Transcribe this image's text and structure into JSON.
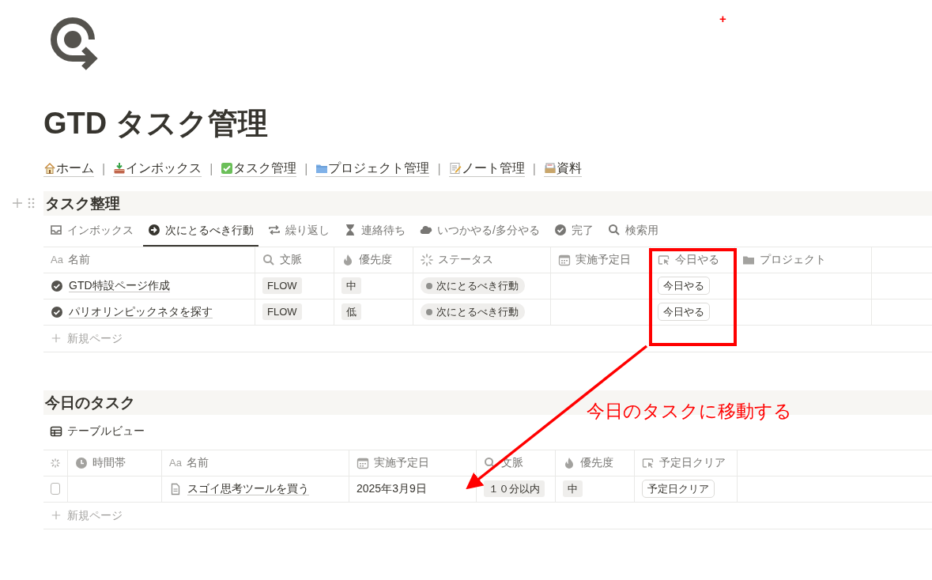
{
  "title": "GTD タスク管理",
  "links": [
    {
      "kind": "home",
      "label": "ホーム"
    },
    {
      "kind": "inbox",
      "label": "インボックス"
    },
    {
      "kind": "check",
      "label": "タスク管理"
    },
    {
      "kind": "folder",
      "label": "プロジェクト管理"
    },
    {
      "kind": "memo",
      "label": "ノート管理"
    },
    {
      "kind": "files",
      "label": "資料"
    }
  ],
  "link_separator": "|",
  "sections": [
    {
      "title": "タスク整理",
      "views": [
        {
          "kind": "inbox",
          "label": "インボックス",
          "selected": false
        },
        {
          "kind": "arrow",
          "label": "次にとるべき行動",
          "selected": true
        },
        {
          "kind": "repeat",
          "label": "繰り返し",
          "selected": false
        },
        {
          "kind": "hourglass",
          "label": "連絡待ち",
          "selected": false
        },
        {
          "kind": "cloud",
          "label": "いつかやる/多分やる",
          "selected": false
        },
        {
          "kind": "done",
          "label": "完了",
          "selected": false
        },
        {
          "kind": "search",
          "label": "検索用",
          "selected": false
        }
      ],
      "columns": [
        {
          "kind": "text",
          "prefix": "Aa",
          "label": "名前"
        },
        {
          "kind": "search",
          "label": "文脈"
        },
        {
          "kind": "fire",
          "label": "優先度"
        },
        {
          "kind": "spinner",
          "label": "ステータス"
        },
        {
          "kind": "calendar",
          "label": "実施予定日"
        },
        {
          "kind": "cursor",
          "label": "今日やる"
        },
        {
          "kind": "folder",
          "label": "プロジェクト"
        },
        {
          "kind": "blank"
        }
      ],
      "rows": [
        [
          {
            "kind": "done_title",
            "text": "GTD特設ページ作成"
          },
          {
            "kind": "tag",
            "text": "FLOW"
          },
          {
            "kind": "tag",
            "text": "中"
          },
          {
            "kind": "status",
            "text": "次にとるべき行動"
          },
          {
            "kind": "empty"
          },
          {
            "kind": "button",
            "text": "今日やる"
          },
          {
            "kind": "empty"
          },
          {
            "kind": "empty"
          }
        ],
        [
          {
            "kind": "done_title",
            "text": "パリオリンピックネタを探す"
          },
          {
            "kind": "tag",
            "text": "FLOW"
          },
          {
            "kind": "tag",
            "text": "低"
          },
          {
            "kind": "status",
            "text": "次にとるべき行動"
          },
          {
            "kind": "empty"
          },
          {
            "kind": "button",
            "text": "今日やる"
          },
          {
            "kind": "empty"
          },
          {
            "kind": "empty"
          }
        ]
      ],
      "new_row": "新規ページ"
    },
    {
      "title": "今日のタスク",
      "views": [
        {
          "kind": "table",
          "label": "テーブルビュー",
          "selected": true
        }
      ],
      "columns": [
        {
          "kind": "spinner"
        },
        {
          "kind": "clock",
          "label": "時間帯"
        },
        {
          "kind": "text",
          "prefix": "Aa",
          "label": "名前"
        },
        {
          "kind": "calendar",
          "label": "実施予定日"
        },
        {
          "kind": "search",
          "label": "文脈"
        },
        {
          "kind": "fire",
          "label": "優先度"
        },
        {
          "kind": "cursor",
          "label": "予定日クリア"
        },
        {
          "kind": "blank"
        }
      ],
      "rows": [
        [
          {
            "kind": "checkbox",
            "checked": false
          },
          {
            "kind": "empty"
          },
          {
            "kind": "page_title",
            "text": "スゴイ思考ツールを買う"
          },
          {
            "kind": "text",
            "text": "2025年3月9日"
          },
          {
            "kind": "tag",
            "text": "１０分以内"
          },
          {
            "kind": "tag",
            "text": "中"
          },
          {
            "kind": "button",
            "text": "予定日クリア"
          },
          {
            "kind": "empty"
          }
        ]
      ],
      "new_row": "新規ページ"
    }
  ],
  "annotation": {
    "text": "今日のタスクに移動する",
    "marker": "+"
  }
}
